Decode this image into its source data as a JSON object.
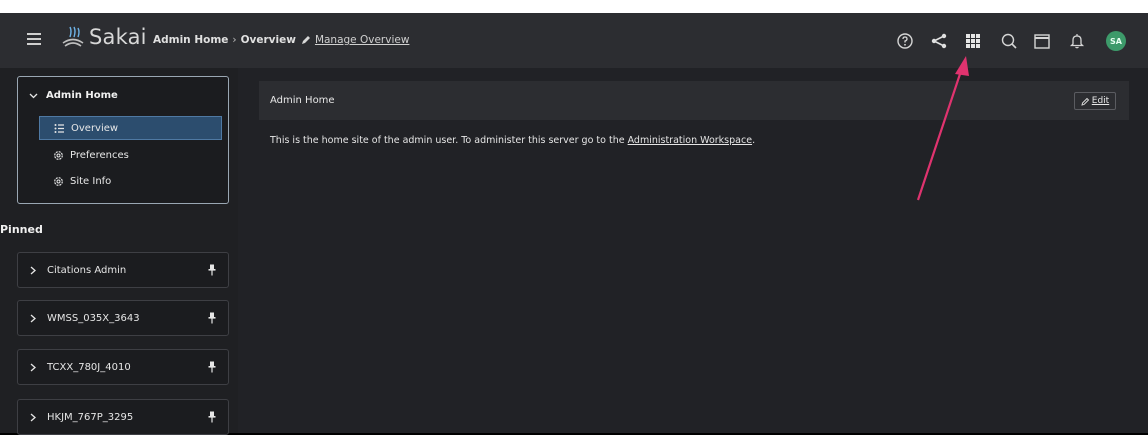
{
  "header": {
    "logo_text": "Sakai",
    "breadcrumb": {
      "site": "Admin Home",
      "separator": "›",
      "page": "Overview",
      "manage_link": "Manage Overview"
    },
    "tools": [
      "help-icon",
      "share-icon",
      "apps-grid-icon",
      "search-icon",
      "calendar-icon",
      "notifications-bell-icon"
    ],
    "avatar_initials": "SA",
    "accent_color": "#3d9a6a"
  },
  "sidebar": {
    "site_title": "Admin Home",
    "items": [
      {
        "label": "Overview",
        "icon": "list-icon",
        "active": true
      },
      {
        "label": "Preferences",
        "icon": "gear-icon",
        "active": false
      },
      {
        "label": "Site Info",
        "icon": "gear-icon",
        "active": false
      }
    ],
    "pinned_title": "Pinned",
    "pinned": [
      {
        "label": "Citations Admin"
      },
      {
        "label": "WMSS_035X_3643"
      },
      {
        "label": "TCXX_780J_4010"
      },
      {
        "label": "HKJM_767P_3295"
      }
    ]
  },
  "main": {
    "card_title": "Admin Home",
    "edit_label": "Edit",
    "body_prefix": "This is the home site of the admin user. To administer this server go to the ",
    "body_link": "Administration Workspace",
    "body_suffix": "."
  },
  "annotation": {
    "arrow_color": "#e0336f"
  }
}
